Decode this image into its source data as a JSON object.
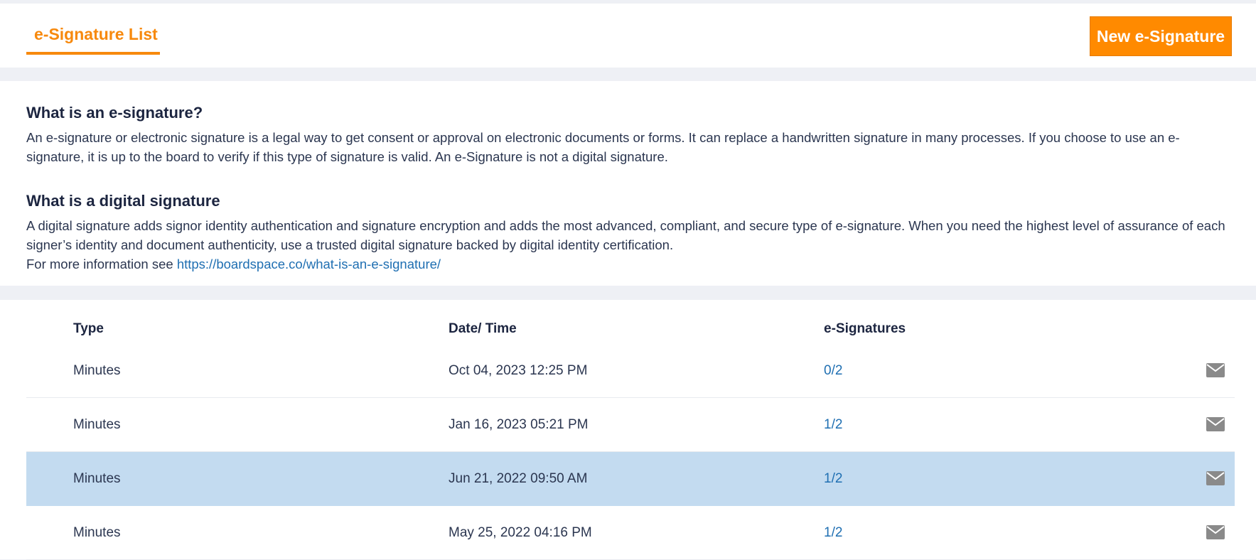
{
  "header": {
    "tab_label": "e-Signature List",
    "new_button_label": "New e-Signature",
    "accent_color": "#ff8a00"
  },
  "info": {
    "heading1": "What is an e-signature?",
    "paragraph1": "An e-signature or electronic signature is a legal way to get consent or approval on electronic documents or forms. It can replace a handwritten signature in many processes. If you choose to use an e-signature, it is up to the board to verify if this type of signature is valid. An e-Signature is not a digital signature.",
    "heading2": "What is a digital signature",
    "paragraph2": "A digital signature adds signor identity authentication and signature encryption and adds the most advanced, compliant, and secure type of e-signature. When you need the highest level of assurance of each signer’s identity and document authenticity, use a trusted digital signature backed by digital identity certification.",
    "more_info_prefix": "For more information see ",
    "more_info_link": "https://boardspace.co/what-is-an-e-signature/"
  },
  "table": {
    "columns": [
      "Type",
      "Date/ Time",
      "e-Signatures"
    ],
    "rows": [
      {
        "type": "Minutes",
        "datetime": "Oct 04, 2023 12:25 PM",
        "signatures": "0/2",
        "icon": "envelope-icon"
      },
      {
        "type": "Minutes",
        "datetime": "Jan 16, 2023 05:21 PM",
        "signatures": "1/2",
        "icon": "envelope-icon"
      },
      {
        "type": "Minutes",
        "datetime": "Jun 21, 2022 09:50 AM",
        "signatures": "1/2",
        "icon": "envelope-icon",
        "selected": true
      },
      {
        "type": "Minutes",
        "datetime": "May 25, 2022 04:16 PM",
        "signatures": "1/2",
        "icon": "envelope-icon"
      }
    ],
    "selected_row_color": "#c3dbf0",
    "link_color": "#1f6fb2"
  }
}
